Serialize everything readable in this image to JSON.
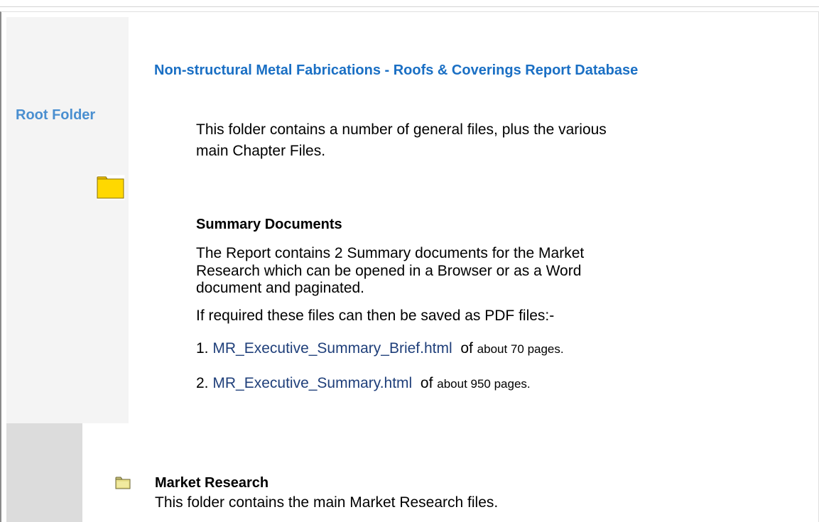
{
  "sidebar": {
    "root_label": "Root Folder"
  },
  "report": {
    "title": "Non-structural Metal Fabrications - Roofs & Coverings Report Database",
    "intro": "This folder contains a number of general files, plus the various main Chapter Files."
  },
  "summary": {
    "heading": "Summary Documents",
    "paragraph": "The Report contains 2 Summary documents for the Market Research which can be opened in a Browser or as a Word document and paginated.",
    "pdf_note": "If required these files can then be saved as PDF files:-",
    "files": [
      {
        "number": "1.",
        "link": "MR_Executive_Summary_Brief.html",
        "of": "of",
        "pages": "about 70 pages."
      },
      {
        "number": "2.",
        "link": "MR_Executive_Summary.html",
        "of": "of",
        "pages": "about 950 pages."
      }
    ]
  },
  "market_research": {
    "heading": "Market Research",
    "description": "This folder contains the main Market Research files."
  },
  "colors": {
    "title_blue": "#1a6fc4",
    "root_label_blue": "#4a8fd0",
    "link_navy": "#1f3f7a",
    "folder_yellow": "#ffd800"
  },
  "icons": {
    "root_folder": "folder-icon",
    "market_research_folder": "folder-icon"
  }
}
